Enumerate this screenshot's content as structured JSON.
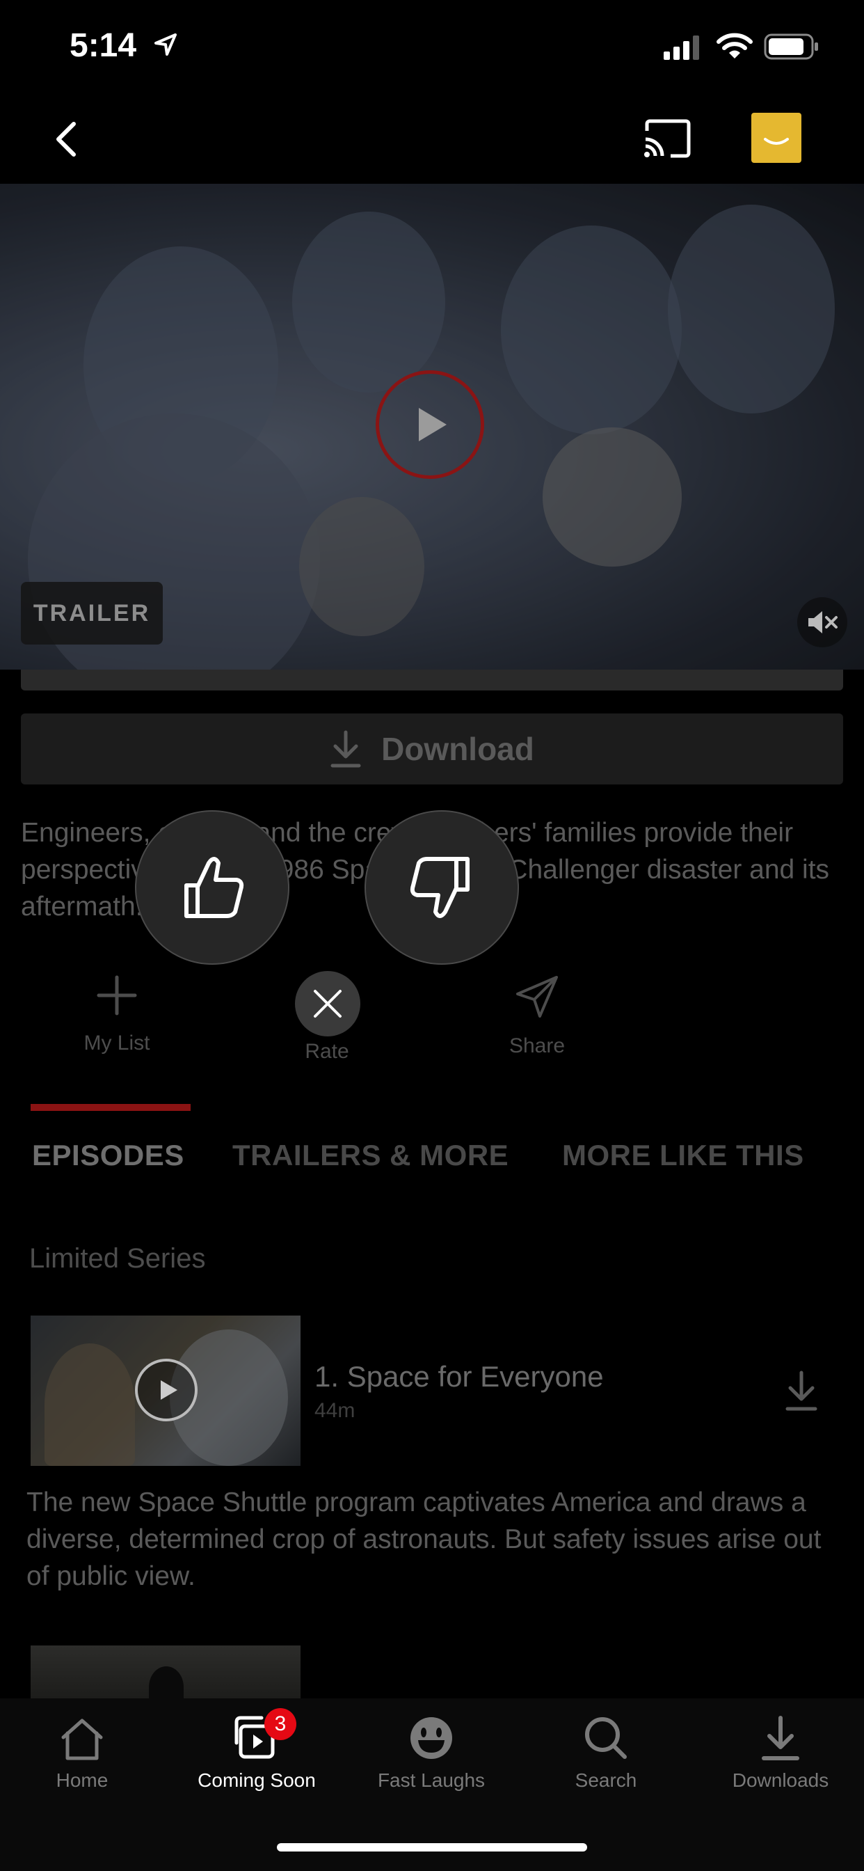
{
  "status_bar": {
    "time": "5:14"
  },
  "video": {
    "badge": "TRAILER"
  },
  "download_label": "Download",
  "description": "Engineers, officials and the crew members' families provide their perspectives on the 1986 Space Shuttle Challenger disaster and its aftermath.",
  "actions": {
    "my_list": "My List",
    "rate": "Rate",
    "share": "Share"
  },
  "tabs": [
    "EPISODES",
    "TRAILERS & MORE",
    "MORE LIKE THIS"
  ],
  "season_label": "Limited Series",
  "episodes": [
    {
      "title": "1. Space for Everyone",
      "duration": "44m",
      "description": "The new Space Shuttle program captivates America and draws a diverse, determined crop of astronauts. But safety issues arise out of public view."
    }
  ],
  "bottom_nav": [
    {
      "label": "Home",
      "icon": "home-icon"
    },
    {
      "label": "Coming Soon",
      "icon": "coming-soon-icon",
      "badge": "3"
    },
    {
      "label": "Fast Laughs",
      "icon": "fast-laughs-icon"
    },
    {
      "label": "Search",
      "icon": "search-icon"
    },
    {
      "label": "Downloads",
      "icon": "downloads-icon"
    }
  ],
  "colors": {
    "accent": "#e50914",
    "background": "#000000"
  }
}
